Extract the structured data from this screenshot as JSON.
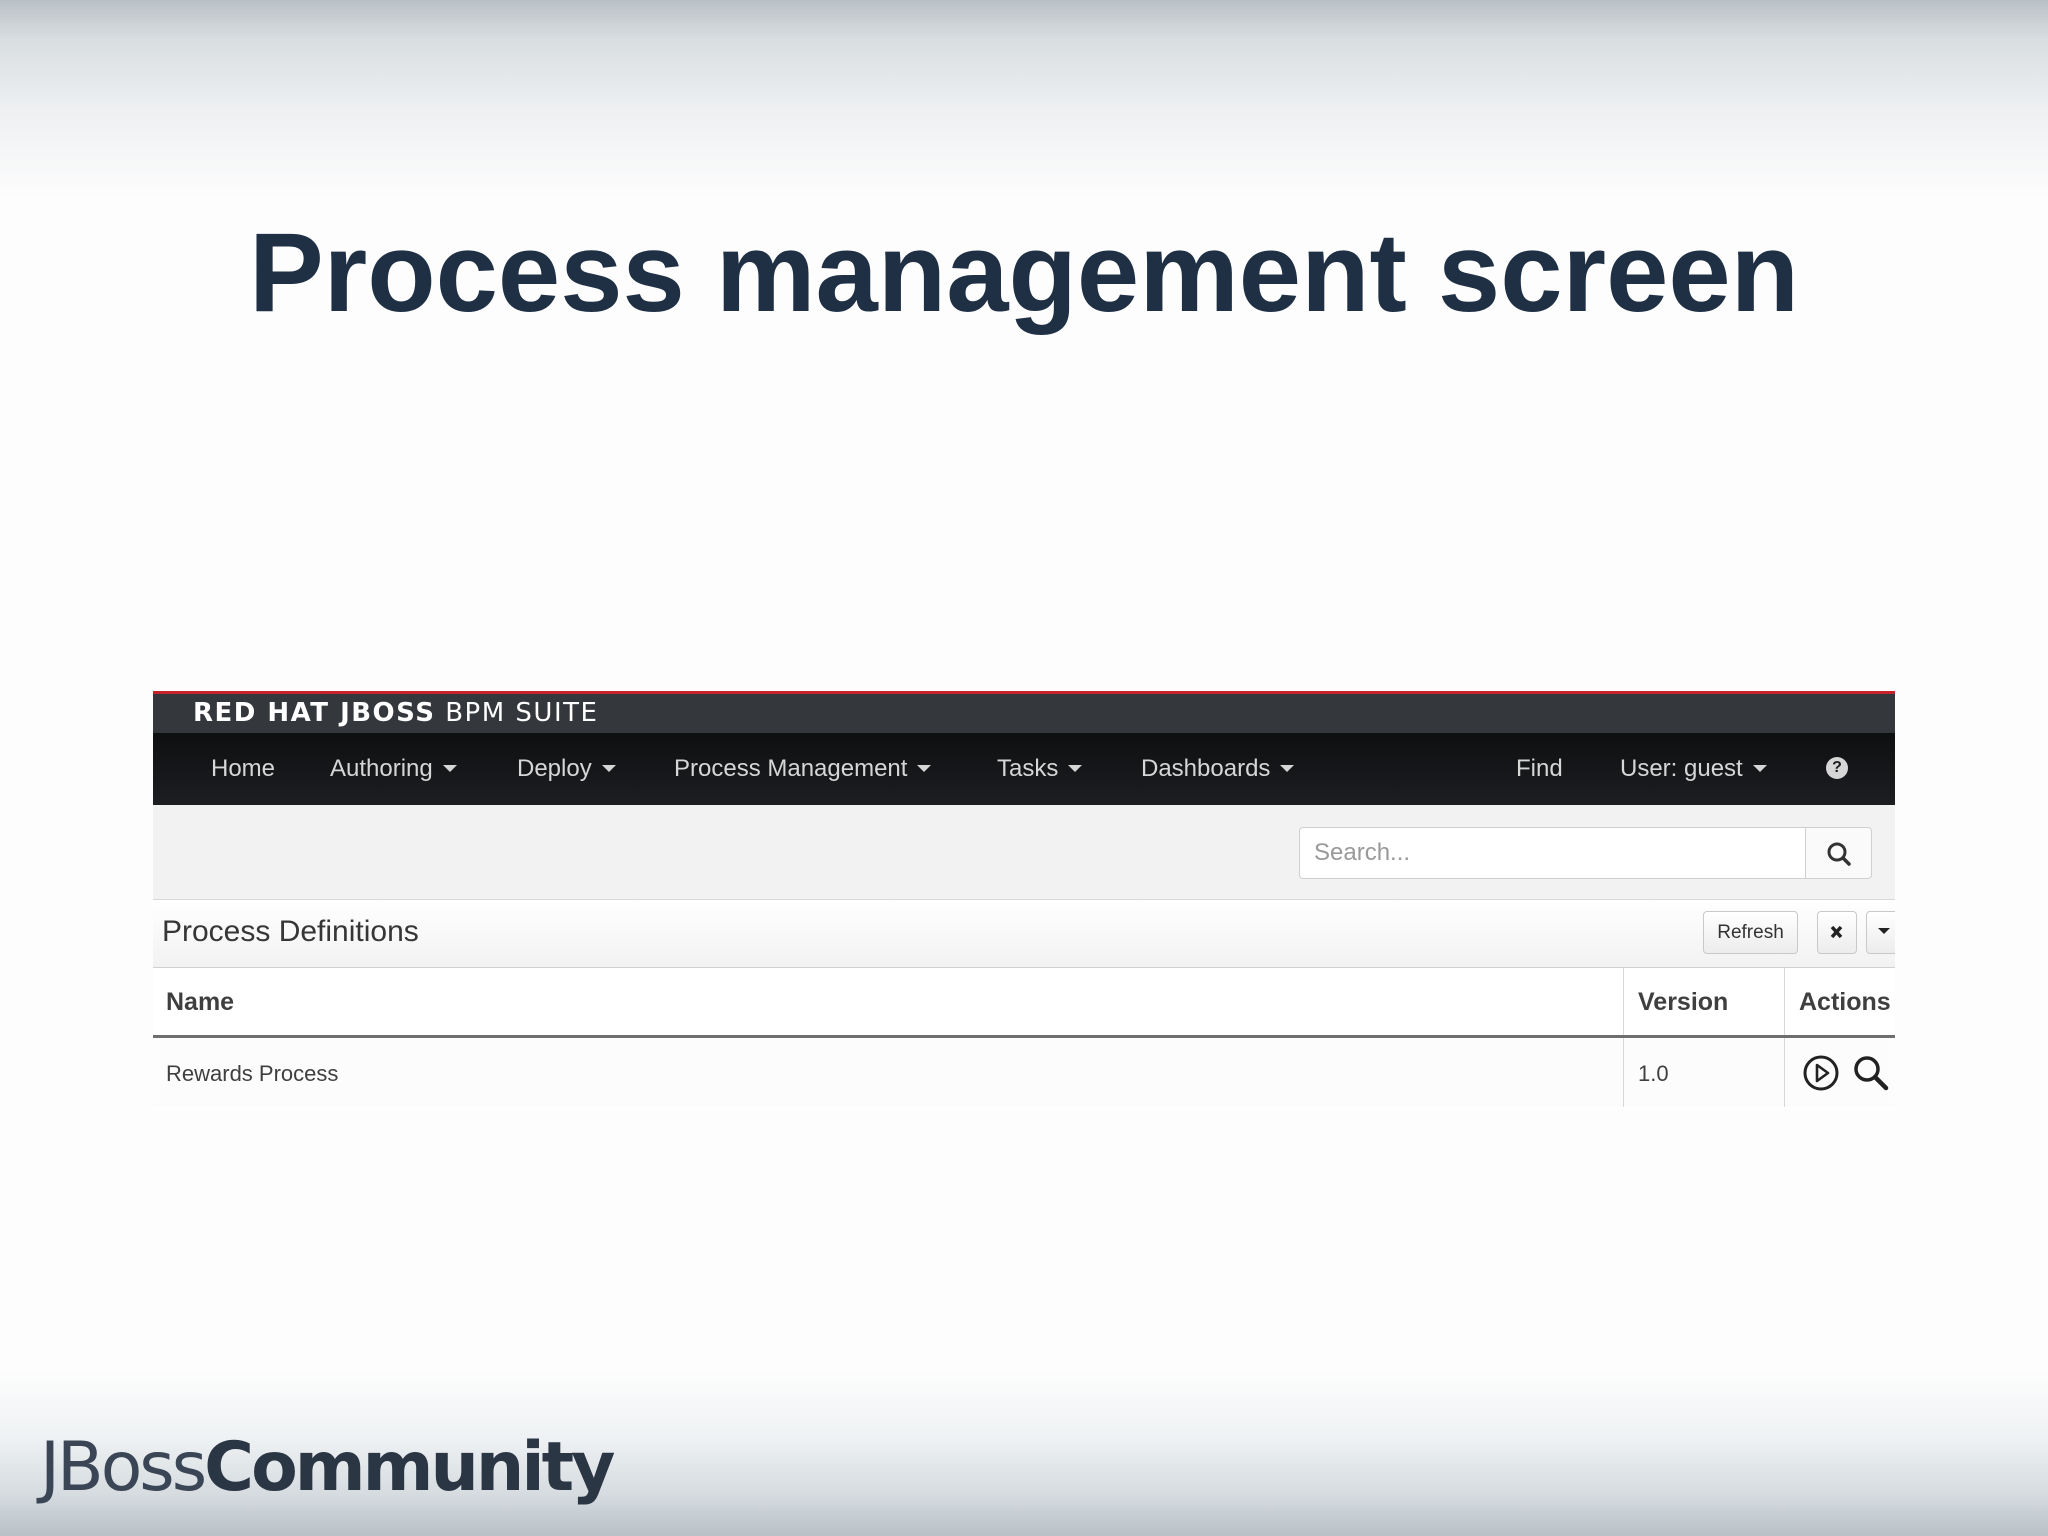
{
  "slide": {
    "title": "Process management screen",
    "footer_logo": {
      "light": "JBoss",
      "bold": "Community"
    }
  },
  "app": {
    "brand": {
      "bold": "RED HAT JBOSS",
      "thin": "BPM SUITE"
    },
    "brand_colors": {
      "accent": "#c8232a",
      "bar": "#34373b",
      "nav": "#121315"
    },
    "nav": {
      "items": [
        "Home",
        "Authoring",
        "Deploy",
        "Process Management",
        "Tasks",
        "Dashboards"
      ],
      "find": "Find",
      "user": "User: guest",
      "help_icon": "question-circle-icon"
    },
    "search": {
      "placeholder": "Search...",
      "icon": "search-icon"
    },
    "panel": {
      "title": "Process Definitions",
      "refresh_label": "Refresh",
      "close_icon": "close-icon",
      "dropdown_icon": "caret-down-icon"
    },
    "table": {
      "columns": [
        "Name",
        "Version",
        "Actions"
      ],
      "rows": [
        {
          "name": "Rewards Process",
          "version": "1.0",
          "actions": [
            "start-process-icon",
            "search-icon"
          ]
        }
      ]
    }
  }
}
